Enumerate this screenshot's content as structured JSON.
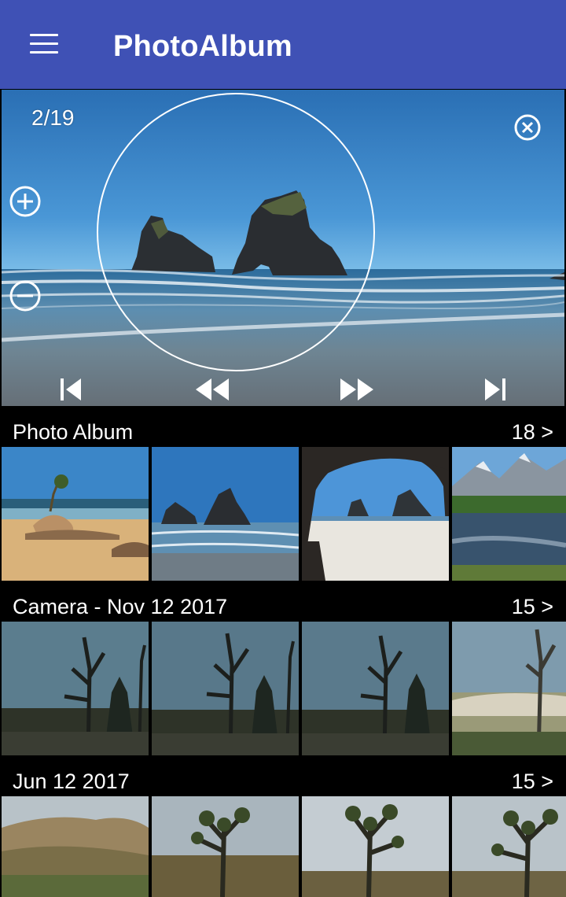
{
  "app_bar": {
    "title": "PhotoAlbum",
    "menu_icon": "hamburger-menu-icon",
    "color": "#3F51B5"
  },
  "viewer": {
    "counter": "2/19",
    "controls": [
      "close-icon",
      "zoom-in-icon",
      "zoom-out-icon",
      "skip-first-icon",
      "rewind-icon",
      "fast-forward-icon",
      "skip-last-icon"
    ]
  },
  "albums": [
    {
      "title": "Photo Album",
      "count": "18 >",
      "thumbnails": [
        "beach-rock-tree",
        "sea-arch-rocks",
        "cave-view-rocks",
        "mountain-lake"
      ]
    },
    {
      "title": "Camera - Nov 12 2017",
      "count": "15 >",
      "thumbnails": [
        "dead-tree-1",
        "dead-tree-2",
        "dead-tree-3",
        "dead-tree-4"
      ]
    },
    {
      "title": "Jun 12 2017",
      "count": "15 >",
      "thumbnails": [
        "desert-hills",
        "joshua-tree-1",
        "joshua-tree-2",
        "joshua-tree-3"
      ]
    }
  ]
}
